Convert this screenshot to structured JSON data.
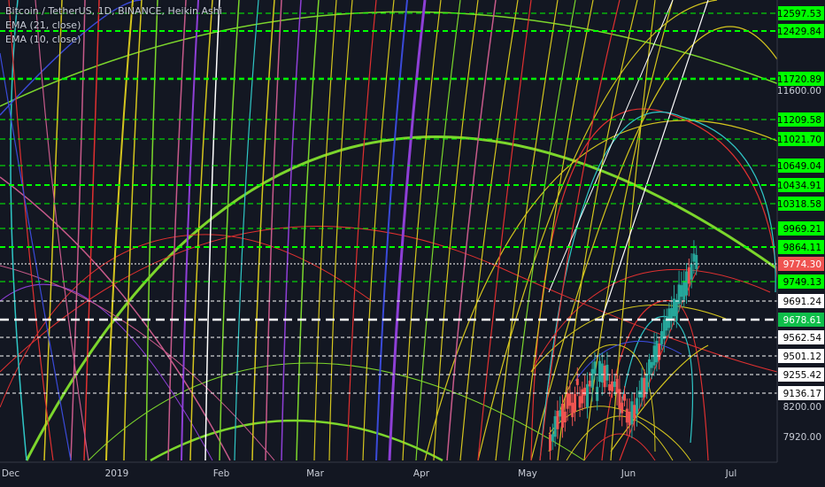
{
  "legend": {
    "title": "Bitcoin / TetherUS, 1D, BINANCE, Heikin Ashi",
    "ema1": "EMA (21, close)",
    "ema2": "EMA (10, close)"
  },
  "colors": {
    "background": "#131722",
    "axis_text": "#c8ccd6",
    "level_green": "#00ff00",
    "level_white": "#ffffff",
    "candle_up": "#26a69a",
    "candle_down": "#ef5350",
    "current_price_bg": "#ef5350",
    "ema_badge_bg": "#0fbf4a"
  },
  "price_axis": [
    {
      "label": "12597.53",
      "value": 12597.53,
      "style": "green"
    },
    {
      "label": "12429.84",
      "value": 12429.84,
      "style": "green"
    },
    {
      "label": "11720.89",
      "value": 11720.89,
      "style": "green"
    },
    {
      "label": "11600.00",
      "value": 11600.0,
      "style": "tick"
    },
    {
      "label": "11209.58",
      "value": 11209.58,
      "style": "green"
    },
    {
      "label": "11021.70",
      "value": 11021.7,
      "style": "green"
    },
    {
      "label": "10649.04",
      "value": 10649.04,
      "style": "green"
    },
    {
      "label": "10434.91",
      "value": 10434.91,
      "style": "green"
    },
    {
      "label": "10318.58",
      "value": 10318.58,
      "style": "green"
    },
    {
      "label": "9969.21",
      "value": 9969.21,
      "style": "green"
    },
    {
      "label": "9864.11",
      "value": 9864.11,
      "style": "green"
    },
    {
      "label": "9774.30",
      "value": 9774.3,
      "style": "current"
    },
    {
      "label": "9749.13",
      "value": 9749.13,
      "style": "green"
    },
    {
      "label": "9691.24",
      "value": 9691.24,
      "style": "white"
    },
    {
      "label": "9678.61",
      "value": 9678.61,
      "style": "ema"
    },
    {
      "label": "9562.54",
      "value": 9562.54,
      "style": "white"
    },
    {
      "label": "9501.12",
      "value": 9501.12,
      "style": "white"
    },
    {
      "label": "9255.42",
      "value": 9255.42,
      "style": "white"
    },
    {
      "label": "9136.17",
      "value": 9136.17,
      "style": "white"
    },
    {
      "label": "8200.00",
      "value": 8200.0,
      "style": "tick"
    },
    {
      "label": "7920.00",
      "value": 7920.0,
      "style": "tick"
    }
  ],
  "time_axis": [
    "Dec",
    "2019",
    "Feb",
    "Mar",
    "Apr",
    "May",
    "Jun",
    "Jul"
  ],
  "chart_data": {
    "type": "candlestick",
    "title": "Bitcoin / TetherUS, 1D, BINANCE, Heikin Ashi",
    "indicators": [
      "EMA (21, close)",
      "EMA (10, close)"
    ],
    "current_price": 9774.3,
    "ema_value": 9678.61,
    "horizontal_levels": [
      12597.53,
      12429.84,
      11720.89,
      11209.58,
      11021.7,
      10649.04,
      10434.91,
      10318.58,
      9969.21,
      9864.11,
      9774.3,
      9749.13,
      9691.24,
      9678.61
    ],
    "x_ticks": [
      "Dec",
      "2019",
      "Feb",
      "Mar",
      "Apr",
      "May",
      "Jun",
      "Jul"
    ],
    "grid": false
  }
}
